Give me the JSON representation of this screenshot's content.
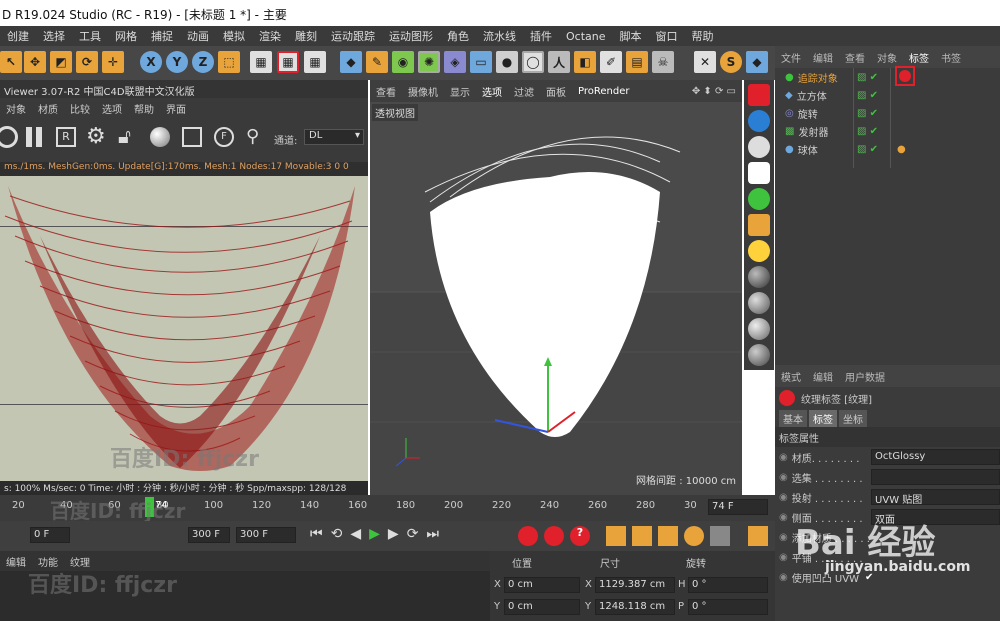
{
  "window": {
    "title": "D R19.024 Studio (RC - R19) - [未标题 1 *] - 主要"
  },
  "menubar": [
    "创建",
    "选择",
    "工具",
    "网格",
    "捕捉",
    "动画",
    "模拟",
    "渲染",
    "雕刻",
    "运动跟踪",
    "运动图形",
    "角色",
    "流水线",
    "插件",
    "Octane",
    "脚本",
    "窗口",
    "帮助"
  ],
  "left_viewer": {
    "title": "Viewer 3.07-R2  中国C4D联盟中文汉化版",
    "menu": [
      "对象",
      "材质",
      "比较",
      "选项",
      "帮助",
      "界面"
    ],
    "channel_label": "通道:",
    "channel_value": "DL",
    "stats": "ms./1ms. MeshGen:0ms. Update[G]:170ms. Mesh:1 Nodes:17 Movable:3  0 0",
    "bottom_stats": "s: 100%    Ms/sec: 0    Time: 小时 : 分钟 : 秒/小时 : 分钟 : 秒    Spp/maxspp: 128/128"
  },
  "viewport": {
    "menu": [
      "查看",
      "摄像机",
      "显示",
      "选项",
      "过滤",
      "面板",
      "ProRender"
    ],
    "label": "透视视图",
    "grid_info": "网格间距 : 10000 cm"
  },
  "object_manager": {
    "menu": [
      "文件",
      "编辑",
      "查看",
      "对象",
      "标签",
      "书签"
    ],
    "objects": [
      {
        "name": "追踪对象",
        "color": "#e8a33b"
      },
      {
        "name": "立方体",
        "color": "#cfcfcf"
      },
      {
        "name": "旋转",
        "color": "#cfcfcf"
      },
      {
        "name": "发射器",
        "color": "#cfcfcf"
      },
      {
        "name": "球体",
        "color": "#cfcfcf"
      }
    ]
  },
  "attributes": {
    "menu": [
      "模式",
      "编辑",
      "用户数据"
    ],
    "tag_title": "纹理标签 [纹理]",
    "tabs": [
      "基本",
      "标签",
      "坐标"
    ],
    "section": "标签属性",
    "rows": [
      {
        "label": "材质. . . . . . . .",
        "value": "OctGlossy"
      },
      {
        "label": "选集 . . . . . . . .",
        "value": ""
      },
      {
        "label": "投射 . . . . . . . .",
        "value": "UVW 贴图"
      },
      {
        "label": "侧面 . . . . . . . .",
        "value": "双面"
      },
      {
        "label": "添加材质 . . . . . .",
        "value": ""
      },
      {
        "label": "平铺 . . . . . . . .",
        "value": ""
      },
      {
        "label": "使用凹凸 UVW",
        "value": "✔"
      }
    ]
  },
  "timeline": {
    "ticks": [
      "20",
      "40",
      "60",
      "80",
      "100",
      "120",
      "140",
      "160",
      "180",
      "200",
      "220",
      "240",
      "260",
      "280",
      "30"
    ],
    "current_frame": "74",
    "frame_field": "74 F",
    "start_field": "0 F",
    "end_field": "300 F",
    "end_field2": "300 F"
  },
  "bottom_left": {
    "menu": [
      "编辑",
      "功能",
      "纹理"
    ]
  },
  "coords": {
    "headers": [
      "位置",
      "尺寸",
      "旋转"
    ],
    "rows": [
      {
        "axis": "X",
        "pos": "0 cm",
        "size_axis": "X",
        "size": "1129.387 cm",
        "rot_axis": "H",
        "rot": "0 °"
      },
      {
        "axis": "Y",
        "pos": "0 cm",
        "size_axis": "Y",
        "size": "1248.118 cm",
        "rot_axis": "P",
        "rot": "0 °"
      }
    ]
  },
  "watermarks": {
    "baidu_id": "百度ID: ffjczr",
    "logo": "Bai 经验",
    "site": "jingyan.baidu.com"
  },
  "colors": {
    "highlight_box": "#e0202a",
    "accent_orange": "#e8a33b",
    "timeline_green": "#3fc33f"
  }
}
